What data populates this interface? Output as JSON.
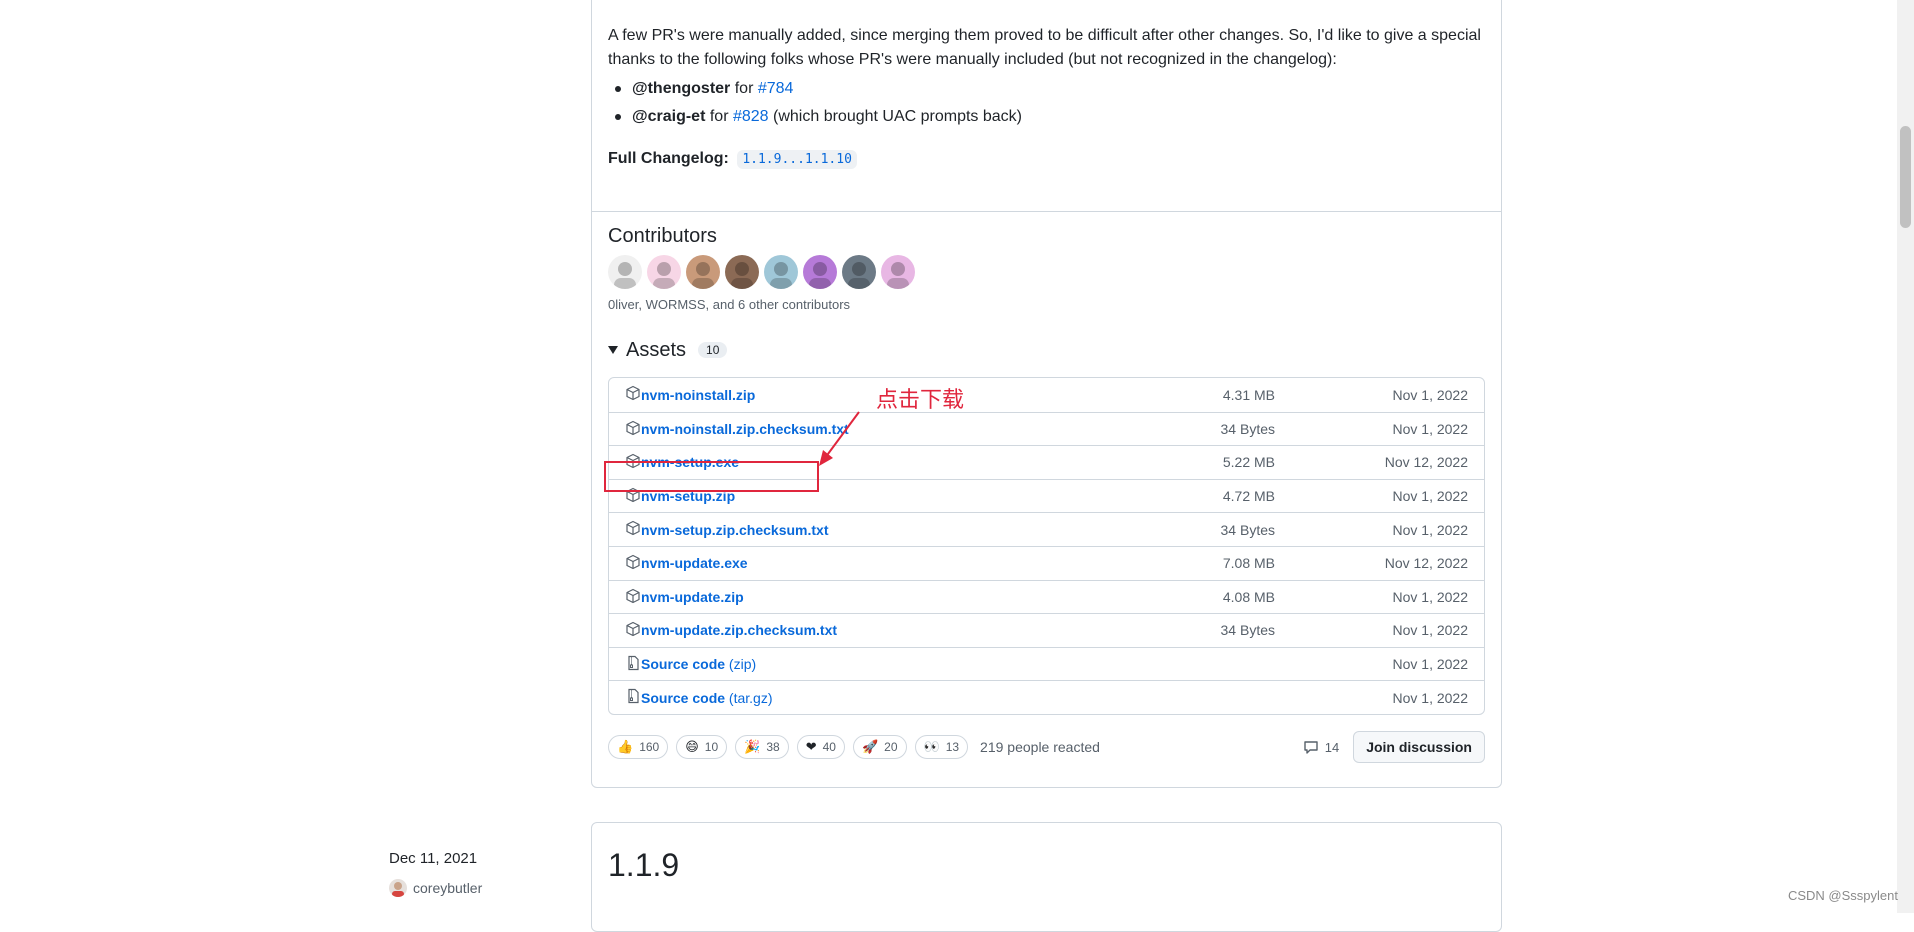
{
  "release": {
    "intro": "A few PR's were manually added, since merging them proved to be difficult after other changes. So, I'd like to give a special thanks to the following folks whose PR's were manually included (but not recognized in the changelog):",
    "pr_items": [
      {
        "user": "@thengoster",
        "for": " for ",
        "pr": "#784",
        "note": ""
      },
      {
        "user": "@craig-et",
        "for": " for ",
        "pr": "#828",
        "note": " (which brought UAC prompts back)"
      }
    ],
    "changelog_label": "Full Changelog:",
    "changelog_range": "1.1.9...1.1.10"
  },
  "contributors": {
    "title": "Contributors",
    "summary": "0liver, WORMSS, and 6 other contributors",
    "avatar_colors": [
      "#f0f0f0",
      "#f7d6e6",
      "#c99a7a",
      "#8b6a55",
      "#9fc7d8",
      "#b67ad8",
      "#6c7a86",
      "#e8b7e4"
    ]
  },
  "assets": {
    "title": "Assets",
    "count": "10",
    "items": [
      {
        "name": "nvm-noinstall.zip",
        "suffix": "",
        "size": "4.31 MB",
        "date": "Nov 1, 2022",
        "kind": "package"
      },
      {
        "name": "nvm-noinstall.zip.checksum.txt",
        "suffix": "",
        "size": "34 Bytes",
        "date": "Nov 1, 2022",
        "kind": "package"
      },
      {
        "name": "nvm-setup.exe",
        "suffix": "",
        "size": "5.22 MB",
        "date": "Nov 12, 2022",
        "kind": "package"
      },
      {
        "name": "nvm-setup.zip",
        "suffix": "",
        "size": "4.72 MB",
        "date": "Nov 1, 2022",
        "kind": "package"
      },
      {
        "name": "nvm-setup.zip.checksum.txt",
        "suffix": "",
        "size": "34 Bytes",
        "date": "Nov 1, 2022",
        "kind": "package"
      },
      {
        "name": "nvm-update.exe",
        "suffix": "",
        "size": "7.08 MB",
        "date": "Nov 12, 2022",
        "kind": "package"
      },
      {
        "name": "nvm-update.zip",
        "suffix": "",
        "size": "4.08 MB",
        "date": "Nov 1, 2022",
        "kind": "package"
      },
      {
        "name": "nvm-update.zip.checksum.txt",
        "suffix": "",
        "size": "34 Bytes",
        "date": "Nov 1, 2022",
        "kind": "package"
      },
      {
        "name": "Source code",
        "suffix": " (zip)",
        "size": "",
        "date": "Nov 1, 2022",
        "kind": "zipfile"
      },
      {
        "name": "Source code",
        "suffix": " (tar.gz)",
        "size": "",
        "date": "Nov 1, 2022",
        "kind": "zipfile"
      }
    ]
  },
  "reactions": {
    "items": [
      {
        "icon": "thumbs-up",
        "glyph": "👍",
        "count": "160"
      },
      {
        "icon": "laugh",
        "glyph": "😄",
        "count": "10"
      },
      {
        "icon": "hooray",
        "glyph": "🎉",
        "count": "38"
      },
      {
        "icon": "heart",
        "glyph": "❤",
        "count": "40"
      },
      {
        "icon": "rocket",
        "glyph": "🚀",
        "count": "20"
      },
      {
        "icon": "eyes",
        "glyph": "👀",
        "count": "13"
      }
    ],
    "summary": "219 people reacted",
    "comments": "14",
    "join_label": "Join discussion"
  },
  "next_release": {
    "title": "1.1.9",
    "date": "Dec 11, 2021",
    "author": "coreybutler"
  },
  "annotation": {
    "text": "点击下载",
    "color": "#e0263d"
  },
  "watermark": "CSDN @Ssspylent"
}
